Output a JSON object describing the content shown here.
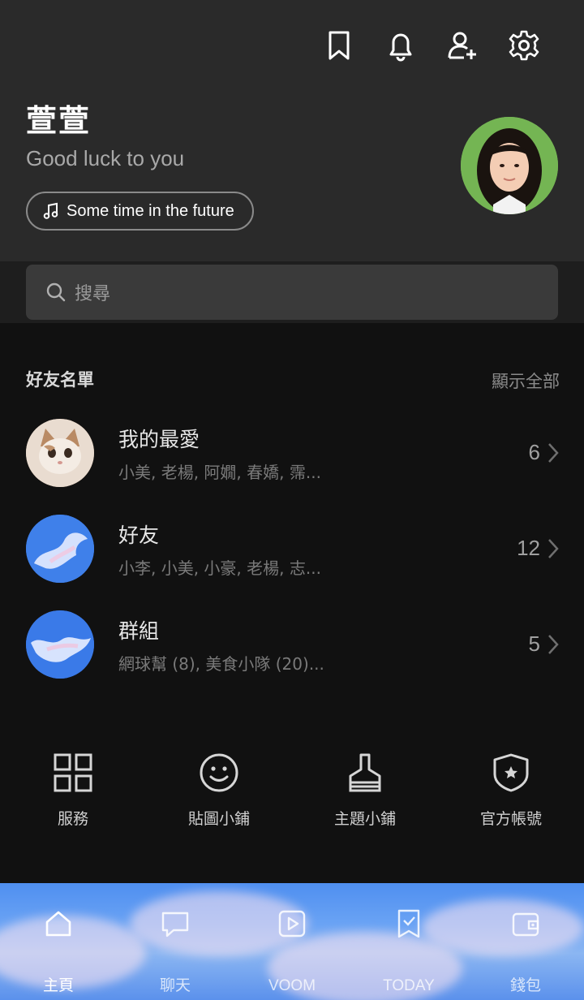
{
  "profile": {
    "name": "萱萱",
    "status_message": "Good luck to you",
    "music": "Some time in the future"
  },
  "search": {
    "placeholder": "搜尋"
  },
  "friends_section": {
    "title": "好友名單",
    "show_all": "顯示全部",
    "groups": [
      {
        "title": "我的最愛",
        "members": "小美, 老楊, 阿嫺, 春嬌, 霈...",
        "count": "6"
      },
      {
        "title": "好友",
        "members": "小李, 小美, 小豪, 老楊, 志...",
        "count": "12"
      },
      {
        "title": "群組",
        "members": "網球幫 (8), 美食小隊 (20)...",
        "count": "5"
      }
    ]
  },
  "services": [
    {
      "label": "服務",
      "icon": "grid-icon"
    },
    {
      "label": "貼圖小鋪",
      "icon": "smiley-icon"
    },
    {
      "label": "主題小鋪",
      "icon": "brush-icon"
    },
    {
      "label": "官方帳號",
      "icon": "shield-star-icon"
    }
  ],
  "bottom_nav": [
    {
      "label": "主頁",
      "icon": "home-icon",
      "active": true
    },
    {
      "label": "聊天",
      "icon": "chat-icon",
      "active": false
    },
    {
      "label": "VOOM",
      "icon": "voom-icon",
      "active": false
    },
    {
      "label": "TODAY",
      "icon": "today-icon",
      "active": false
    },
    {
      "label": "錢包",
      "icon": "wallet-icon",
      "active": false
    }
  ]
}
